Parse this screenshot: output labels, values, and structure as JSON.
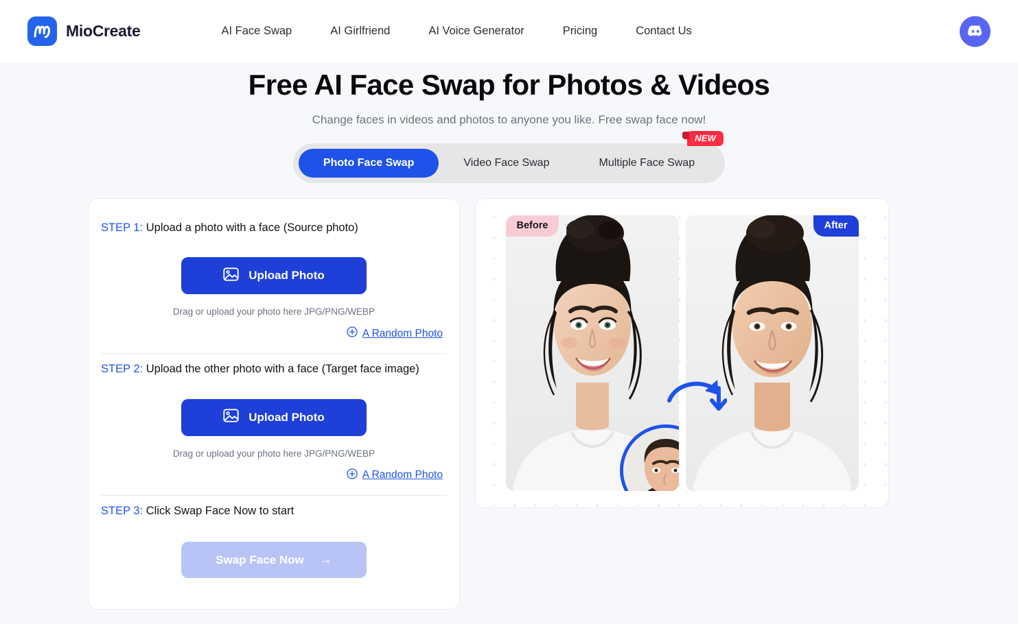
{
  "header": {
    "brand_name": "MioCreate",
    "logo_icon": "miocreate-m-logo-icon",
    "nav": [
      {
        "label": "AI Face Swap"
      },
      {
        "label": "AI Girlfriend"
      },
      {
        "label": "AI Voice Generator"
      },
      {
        "label": "Pricing"
      },
      {
        "label": "Contact Us"
      }
    ],
    "discord_icon": "discord-icon",
    "discord_color": "#5865f2"
  },
  "hero": {
    "title": "Free AI Face Swap for Photos & Videos",
    "subtitle": "Change faces in videos and photos to anyone you like. Free swap face now!"
  },
  "tabs": {
    "items": [
      {
        "label": "Photo Face Swap",
        "active": true
      },
      {
        "label": "Video Face Swap",
        "active": false
      },
      {
        "label": "Multiple Face Swap",
        "active": false
      }
    ],
    "badge": "NEW",
    "badge_color": "#fb2c43",
    "active_color": "#1e52e8",
    "track_color": "#e6e6e6"
  },
  "steps": [
    {
      "num_label": "STEP 1:",
      "text": " Upload a photo with a face (Source photo)",
      "upload_label": "Upload Photo",
      "upload_icon": "image-upload-icon",
      "hint": "Drag or upload your photo here JPG/PNG/WEBP",
      "random_label": "A Random Photo",
      "random_icon": "plus-circle-icon"
    },
    {
      "num_label": "STEP 2:",
      "text": " Upload the other photo with a face (Target face image)",
      "upload_label": "Upload Photo",
      "upload_icon": "image-upload-icon",
      "hint": "Drag or upload your photo here JPG/PNG/WEBP",
      "random_label": "A Random Photo",
      "random_icon": "plus-circle-icon"
    },
    {
      "num_label": "STEP 3:",
      "text": " Click Swap Face Now to start",
      "swap_label": "Swap Face Now",
      "swap_arrow": "→"
    }
  ],
  "preview": {
    "before_tag": "Before",
    "after_tag": "After",
    "before_tag_color": "#f9ccd5",
    "after_tag_color": "#1e3fd8",
    "source_face_icon": "source-face-thumbnail",
    "arrow_icon": "curved-swap-arrow-icon",
    "accent_color": "#1e52e8"
  }
}
